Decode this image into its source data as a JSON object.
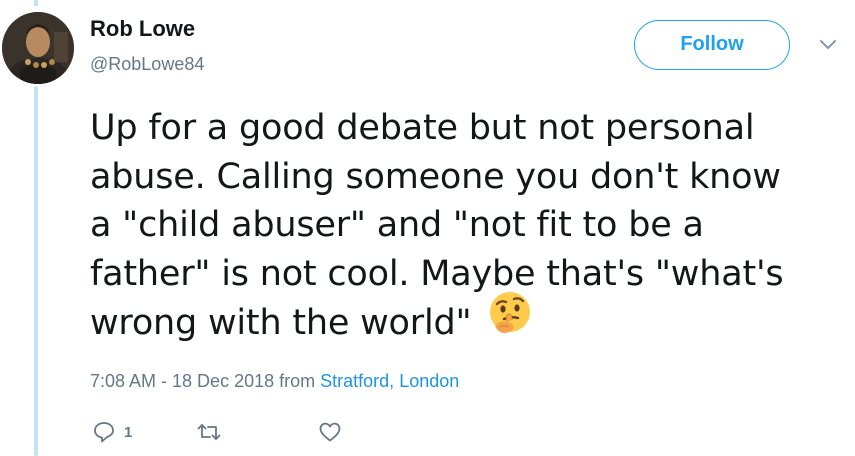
{
  "author": {
    "name": "Rob Lowe",
    "handle": "@RobLowe84"
  },
  "follow_label": "Follow",
  "tweet": {
    "lines": [
      "Up for a good debate but not personal",
      "abuse. Calling someone you don't know",
      "a \"child abuser\" and \"not fit to be a",
      "father\" is not cool. Maybe that's \"what's",
      "wrong with the world\""
    ],
    "emoji": "thinking-face"
  },
  "meta": {
    "timestamp": "7:08 AM - 18 Dec 2018",
    "from_word": "from",
    "location": "Stratford, London"
  },
  "actions": {
    "reply_count": "1"
  },
  "colors": {
    "accent": "#1da1f2",
    "link": "#1b95e0",
    "muted": "#657786",
    "text": "#14171a",
    "thread_line": "#c4e3f6"
  }
}
